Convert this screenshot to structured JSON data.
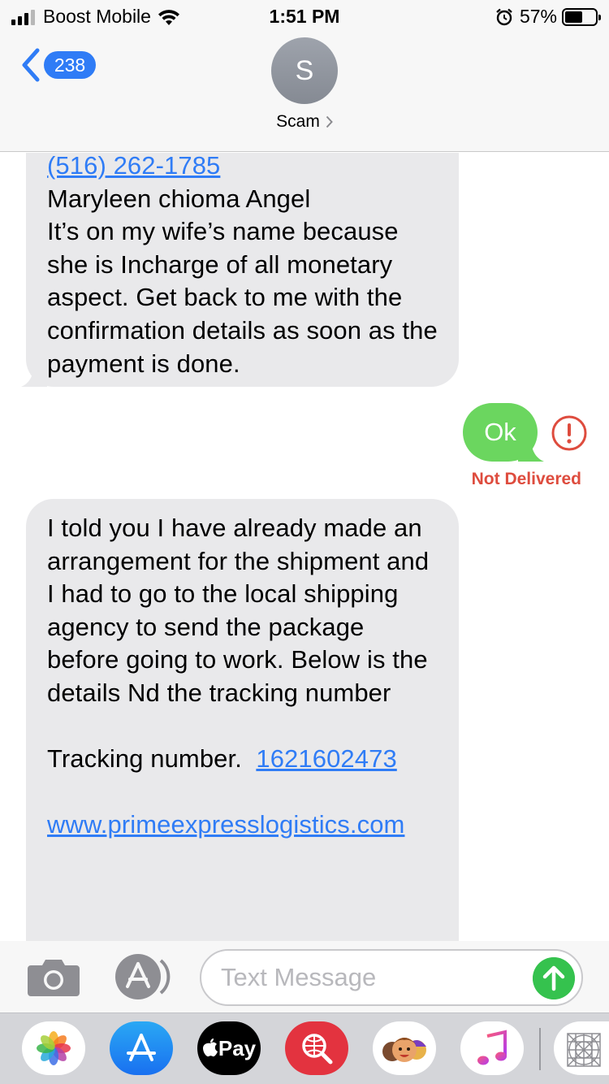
{
  "status_bar": {
    "carrier": "Boost Mobile",
    "time": "1:51 PM",
    "battery_percent": "57%",
    "battery_level": 0.57,
    "signal_bars": 3,
    "icons": [
      "signal-icon",
      "wifi-icon",
      "alarm-icon",
      "battery-icon"
    ]
  },
  "header": {
    "back_badge_count": "238",
    "avatar_initial": "S",
    "contact_name": "Scam",
    "icons": [
      "back-chevron-icon",
      "contact-chevron-icon"
    ]
  },
  "messages": [
    {
      "direction": "incoming",
      "link_phone": "(516) 262-1785",
      "text": "Maryleen chioma Angel\nIt’s on my wife’s name because she is Incharge of all monetary aspect. Get back to me with the confirmation details as soon as the payment is done."
    },
    {
      "direction": "outgoing",
      "text": "Ok",
      "status": "Not Delivered",
      "error_icon": "exclamation-circle-icon"
    },
    {
      "direction": "incoming",
      "text": "I told you I have already made an arrangement for the shipment and I had to go to the local shipping agency to send the package before going to work. Below is the details Nd the tracking number",
      "tracking_label": "Tracking number.  ",
      "tracking_number": "1621602473",
      "website_link": "www.primeexpresslogistics.com"
    }
  ],
  "compose": {
    "placeholder": "Text Message",
    "value": "",
    "icons": [
      "camera-icon",
      "app-store-icon",
      "send-arrow-icon"
    ]
  },
  "app_drawer": {
    "pay_label": "Pay",
    "apps": [
      "photos-app-icon",
      "app-store-app-icon",
      "apple-pay-app-icon",
      "web-search-app-icon",
      "memoji-app-icon",
      "music-app-icon",
      "more-apps-icon"
    ]
  },
  "colors": {
    "ios_blue": "#2f7cf6",
    "incoming_bubble": "#e9e9eb",
    "outgoing_sms_bubble": "#6bd65f",
    "error_red": "#de4c3e",
    "send_button": "#35c24e"
  }
}
